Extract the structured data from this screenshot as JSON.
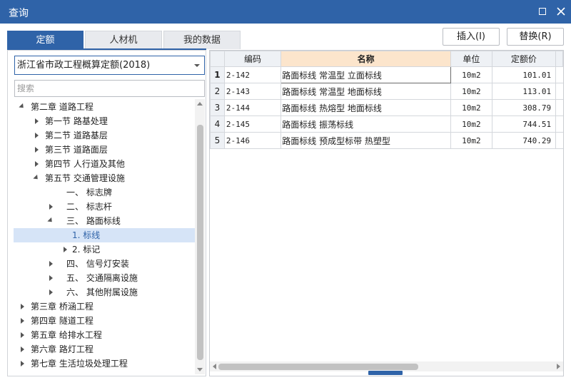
{
  "window": {
    "title": "查询"
  },
  "tabs": [
    {
      "label": "定额",
      "active": true
    },
    {
      "label": "人材机",
      "active": false
    },
    {
      "label": "我的数据",
      "active": false
    }
  ],
  "actions": {
    "insert": "插入(I)",
    "replace": "替换(R)"
  },
  "library": {
    "selected": "浙江省市政工程概算定额(2018)"
  },
  "search": {
    "placeholder": "搜索",
    "value": ""
  },
  "tree": [
    {
      "label": "第二章 道路工程",
      "level": 0,
      "state": "expanded",
      "selected": false
    },
    {
      "label": "第一节 路基处理",
      "level": 1,
      "state": "collapsed",
      "selected": false
    },
    {
      "label": "第二节 道路基层",
      "level": 1,
      "state": "collapsed",
      "selected": false
    },
    {
      "label": "第三节 道路面层",
      "level": 1,
      "state": "collapsed",
      "selected": false
    },
    {
      "label": "第四节 人行道及其他",
      "level": 1,
      "state": "collapsed",
      "selected": false
    },
    {
      "label": "第五节 交通管理设施",
      "level": 1,
      "state": "expanded",
      "selected": false
    },
    {
      "label": "一、 标志牌",
      "level": 2,
      "state": "none",
      "selected": false
    },
    {
      "label": "二、 标志杆",
      "level": 2,
      "state": "collapsed",
      "selected": false
    },
    {
      "label": "三、 路面标线",
      "level": 2,
      "state": "expanded",
      "selected": false
    },
    {
      "label": "1. 标线",
      "level": 3,
      "state": "none",
      "selected": true
    },
    {
      "label": "2. 标记",
      "level": 3,
      "state": "collapsed",
      "selected": false
    },
    {
      "label": "四、 信号灯安装",
      "level": 2,
      "state": "collapsed",
      "selected": false
    },
    {
      "label": "五、 交通隔离设施",
      "level": 2,
      "state": "collapsed",
      "selected": false
    },
    {
      "label": "六、 其他附属设施",
      "level": 2,
      "state": "collapsed",
      "selected": false
    },
    {
      "label": "第三章 桥涵工程",
      "level": 0,
      "state": "collapsed",
      "selected": false
    },
    {
      "label": "第四章 隧道工程",
      "level": 0,
      "state": "collapsed",
      "selected": false
    },
    {
      "label": "第五章 给排水工程",
      "level": 0,
      "state": "collapsed",
      "selected": false
    },
    {
      "label": "第六章 路灯工程",
      "level": 0,
      "state": "collapsed",
      "selected": false
    },
    {
      "label": "第七章 生活垃圾处理工程",
      "level": 0,
      "state": "collapsed",
      "selected": false
    }
  ],
  "table": {
    "columns": [
      "编码",
      "名称",
      "单位",
      "定额价"
    ],
    "rows": [
      {
        "no": "1",
        "code": "2-142",
        "name": "路面标线 常温型 立面标线",
        "unit": "10m2",
        "price": "101.01"
      },
      {
        "no": "2",
        "code": "2-143",
        "name": "路面标线 常温型 地面标线",
        "unit": "10m2",
        "price": "113.01"
      },
      {
        "no": "3",
        "code": "2-144",
        "name": "路面标线 热熔型 地面标线",
        "unit": "10m2",
        "price": "308.79"
      },
      {
        "no": "4",
        "code": "2-145",
        "name": "路面标线 振荡标线",
        "unit": "10m2",
        "price": "744.51"
      },
      {
        "no": "5",
        "code": "2-146",
        "name": "路面标线 预成型标带 热塑型",
        "unit": "10m2",
        "price": "740.29"
      }
    ]
  },
  "colors": {
    "accent": "#2f63a8",
    "selected_row": "#d6e4f7",
    "sorted_header": "#fce5cc"
  },
  "icons": [
    "maximize-icon",
    "close-icon",
    "dropdown-caret-icon",
    "tree-arrow-icon"
  ]
}
